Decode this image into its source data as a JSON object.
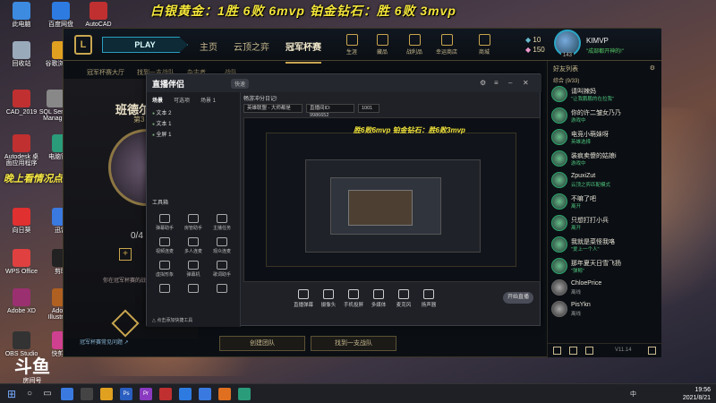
{
  "overlay": {
    "banner_text": "白银黄金：1胜 6败 6mvp   铂金钻石：胜 6败 3mvp",
    "left_caption": "晚上看情况点小姐姐"
  },
  "desktop_icons": [
    {
      "label": "此电脑",
      "color": "#3c8be0"
    },
    {
      "label": "百度网盘",
      "color": "#2d7be0"
    },
    {
      "label": "AutoCAD",
      "color": "#c03030"
    },
    {
      "label": "回收站",
      "color": "#9ab"
    },
    {
      "label": "谷歌浏览器",
      "color": "#e0a020"
    },
    {
      "label": "CAD_2019",
      "color": "#c03030"
    },
    {
      "label": "SQL Server Manager",
      "color": "#888"
    },
    {
      "label": "Autodesk 桌面应用程序",
      "color": "#c03030"
    },
    {
      "label": "电脑管家",
      "color": "#2a9c7a"
    },
    {
      "label": "向日葵",
      "color": "#e03030"
    },
    {
      "label": "迅雷",
      "color": "#3a7ae0"
    },
    {
      "label": "WPS Office",
      "color": "#e04040"
    },
    {
      "label": "剪映",
      "color": "#222"
    },
    {
      "label": "Adobe XD",
      "color": "#9a3070"
    },
    {
      "label": "Adobe Illustrat...",
      "color": "#b06020"
    },
    {
      "label": "OBS Studio",
      "color": "#333"
    },
    {
      "label": "快剪辑",
      "color": "#d04090"
    }
  ],
  "client": {
    "logo": "L",
    "play_label": "PLAY",
    "nav_tabs": [
      "主页",
      "云顶之弈",
      "冠军杯赛"
    ],
    "top_icons": [
      "生涯",
      "藏品",
      "战利品",
      "幸运商店",
      "商城"
    ],
    "currency": {
      "be": "10",
      "rp": "150"
    },
    "user": {
      "name": "KIMVP",
      "status": "\"成部都开神的!\"",
      "level": "143"
    },
    "sub_tabs": [
      "冠军杯赛大厅",
      "找到一支战队",
      "杂志者",
      "战队"
    ],
    "champ_name": "班德尔",
    "champ_sub": "第3",
    "count": "0/4",
    "left_note": "你在冠军杯赛的战队 目前人",
    "left_footer": "冠军杯赛常见问题 ↗",
    "bottom_buttons": [
      "创建团队",
      "找到一支战队"
    ]
  },
  "friends": {
    "header": "好友列表",
    "group": "综合 (9/33)",
    "list": [
      {
        "name": "请叫辣妈",
        "status": "\"让我鹏鹏的在拉我\"",
        "offline": false
      },
      {
        "name": "你的许二皱女乃乃",
        "status": "游戏中",
        "offline": false
      },
      {
        "name": "电竞小萌妹呀",
        "status": "英雄选择",
        "offline": false
      },
      {
        "name": "装疯卖傻的姑娘i",
        "status": "游戏中",
        "offline": false
      },
      {
        "name": "ZpuxiZut",
        "status": "云顶之弈匹配模式",
        "offline": false
      },
      {
        "name": "不嘛了吧",
        "status": "离开",
        "offline": false
      },
      {
        "name": "只想打打小兵",
        "status": "离开",
        "offline": false
      },
      {
        "name": "我就是菜怪我咯",
        "status": "\"爱上一个人\"",
        "offline": false
      },
      {
        "name": "那年夏天日雪飞扬",
        "status": "\"弹鲸\"",
        "offline": false
      },
      {
        "name": "ChloePrice",
        "status": "离线",
        "offline": true
      },
      {
        "name": "PisYkn",
        "status": "离线",
        "offline": true
      }
    ],
    "version": "V11.14"
  },
  "stream": {
    "logo": "直播伴侣",
    "version": "快速",
    "left_tabs": [
      "场景",
      "可选项",
      "场景 1"
    ],
    "sources": [
      "文本 2",
      "文本 1",
      "全屏 1"
    ],
    "tools_title": "工具箱",
    "tools": [
      "弹幕助手",
      "房管助手",
      "主播任务",
      "视频连麦",
      "多人连麦",
      "观众连麦",
      "虚拟形象",
      "弹幕机",
      "歌词助手",
      "",
      "",
      ""
    ],
    "tip": "△ 点击添加快捷工具",
    "top_line": "畅游冲分日记!",
    "inputs": [
      "英雄联盟 - 大师都是",
      "直播间ID: 9986652",
      "1001"
    ],
    "preview_overlay": "胜6败6mvp 铂金钻石：胜6败3mvp",
    "bottom_tools": [
      "直播弹幕",
      "摄像头",
      "手机投屏",
      "多媒体",
      "麦克风",
      "扬声器"
    ],
    "go_live": "开始直播"
  },
  "watermark": {
    "glyph": "斗鱼",
    "room_label": "房间号",
    "room_id": "9986652"
  },
  "taskbar": {
    "apps": [
      {
        "label": "",
        "color": "#3a7ae0"
      },
      {
        "label": "",
        "color": "#444"
      },
      {
        "label": "",
        "color": "#e0a020"
      },
      {
        "label": "Ps",
        "color": "#2a5ec0"
      },
      {
        "label": "Pr",
        "color": "#8a3ac0"
      },
      {
        "label": "",
        "color": "#c03030"
      },
      {
        "label": "",
        "color": "#2d7be0"
      },
      {
        "label": "",
        "color": "#3a7ae0"
      },
      {
        "label": "",
        "color": "#e07020"
      },
      {
        "label": "",
        "color": "#2a9c7a"
      }
    ],
    "lang": "中",
    "time": "19:56",
    "date": "2021/8/21"
  }
}
